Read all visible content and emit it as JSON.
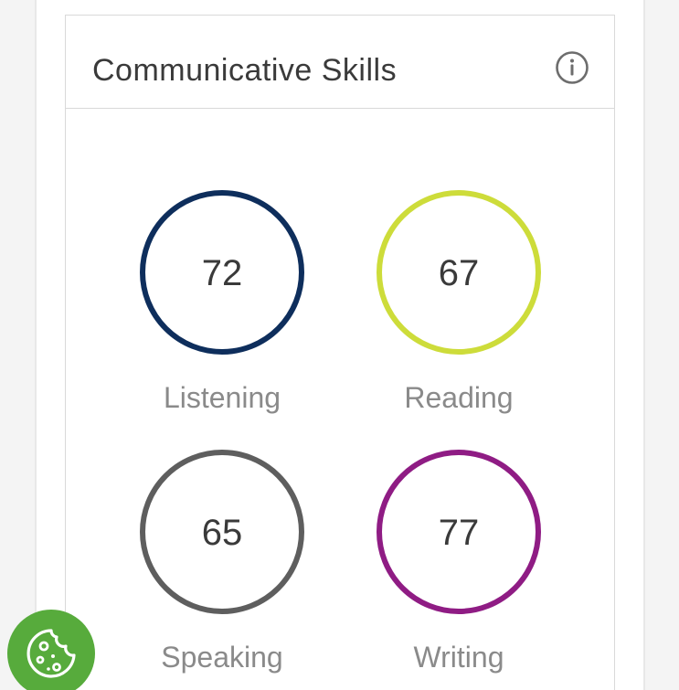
{
  "card": {
    "title": "Communicative Skills",
    "info_icon": "info-icon"
  },
  "skills": [
    {
      "label": "Listening",
      "score": "72",
      "color": "#0e2e5c"
    },
    {
      "label": "Reading",
      "score": "67",
      "color": "#cddc3a"
    },
    {
      "label": "Speaking",
      "score": "65",
      "color": "#5e5e5e"
    },
    {
      "label": "Writing",
      "score": "77",
      "color": "#8f1c84"
    }
  ],
  "floating_button": {
    "icon": "cookie-icon",
    "color": "#57ab3c"
  }
}
